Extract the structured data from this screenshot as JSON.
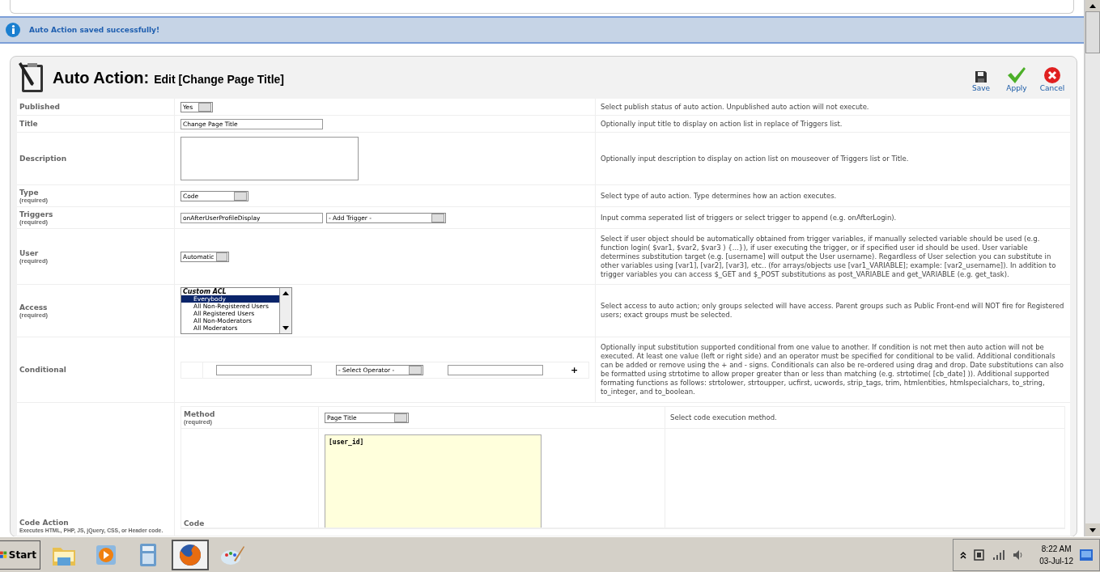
{
  "message": {
    "text": "Auto Action saved successfully!"
  },
  "header": {
    "title": "Auto Action:",
    "subtitle": "Edit [Change Page Title]"
  },
  "toolbar": [
    {
      "kind": "save",
      "label": "Save"
    },
    {
      "kind": "apply",
      "label": "Apply"
    },
    {
      "kind": "cancel",
      "label": "Cancel"
    }
  ],
  "rows": [
    {
      "label": "Published",
      "kind": "select",
      "value": "Yes",
      "description": "Select publish status of auto action. Unpublished auto action will not execute."
    },
    {
      "label": "Title",
      "kind": "text",
      "value": "Change Page Title",
      "description": "Optionally input title to display on action list in replace of Triggers list."
    },
    {
      "label": "Description",
      "kind": "textarea",
      "description": "Optionally input description to display on action list on mouseover of Triggers list or Title."
    },
    {
      "label": "Type",
      "required_text": "(required)",
      "kind": "select",
      "value": "Code",
      "description": "Select type of auto action. Type determines how an action executes."
    },
    {
      "label": "Triggers",
      "required_text": "(required)",
      "kind": "triggers",
      "value": "onAfterUserProfileDisplay",
      "select": "- Add Trigger -",
      "description": "Input comma seperated list of triggers or select trigger to append (e.g. onAfterLogin)."
    },
    {
      "label": "User",
      "required_text": "(required)",
      "kind": "select",
      "value": "Automatic",
      "description": "Select if user object should be automatically obtained from trigger variables, if manually selected variable should be used (e.g. function login( $var1, $var2, $var3 ) {...}), if user executing the trigger, or if specified user id should be used. User variable determines substitution target (e.g. [username] will output the User username). Regardless of User selection you can substitute in other variables using [var1], [var2], [var3], etc.. (for arrays/objects use [var1_VARIABLE]; example: [var2_username]). In addition to trigger variables you can access $_GET and $_POST substitutions as post_VARIABLE and get_VARIABLE (e.g. get_task)."
    },
    {
      "label": "Access",
      "required_text": "(required)",
      "kind": "listbox",
      "group": "Custom ACL",
      "options": [
        {
          "label": "Everybody",
          "selected": true
        },
        {
          "label": "All Non-Registered Users",
          "selected": false
        },
        {
          "label": "All Registered Users",
          "selected": false
        },
        {
          "label": "All Non-Moderators",
          "selected": false
        },
        {
          "label": "All Moderators",
          "selected": false
        }
      ],
      "description": "Select access to auto action; only groups selected will have access. Parent groups such as Public Front-end will NOT fire for Registered users; exact groups must be selected."
    },
    {
      "label": "Conditional",
      "kind": "conditional",
      "operator": "- Select Operator -",
      "add": "+",
      "description": "Optionally input substitution supported conditional from one value to another. If condition is not met then auto action will not be executed. At least one value (left or right side) and an operator must be specified for conditional to be valid. Additional conditionals can be added or remove using the + and - signs. Conditionals can also be re-ordered using drag and drop. Date substitutions can also be formatted using strtotime to allow proper greater than or less than matching (e.g. strtotime( [cb_date] )). Additional supported formating functions as follows: strtolower, strtoupper, ucfirst, ucwords, strip_tags, trim, htmlentities, htmlspecialchars, to_string, to_integer, and to_boolean."
    }
  ],
  "code_action": {
    "label": "Code Action",
    "hint": "Executes HTML, PHP, JS, jQuery, CSS, or Header code.",
    "method": {
      "label": "Method",
      "required_text": "(required)",
      "value": "Page Title",
      "description": "Select code execution method."
    },
    "code": {
      "label": "Code",
      "value": "[user_id]"
    }
  },
  "taskbar": {
    "start": "Start",
    "apps": [
      {
        "kind": "folder",
        "selected": false
      },
      {
        "kind": "media",
        "selected": false
      },
      {
        "kind": "calculator",
        "selected": false
      },
      {
        "kind": "browser",
        "selected": true
      },
      {
        "kind": "paint",
        "selected": false
      }
    ],
    "time": "8:22 AM",
    "date": "03-Jul-12"
  }
}
